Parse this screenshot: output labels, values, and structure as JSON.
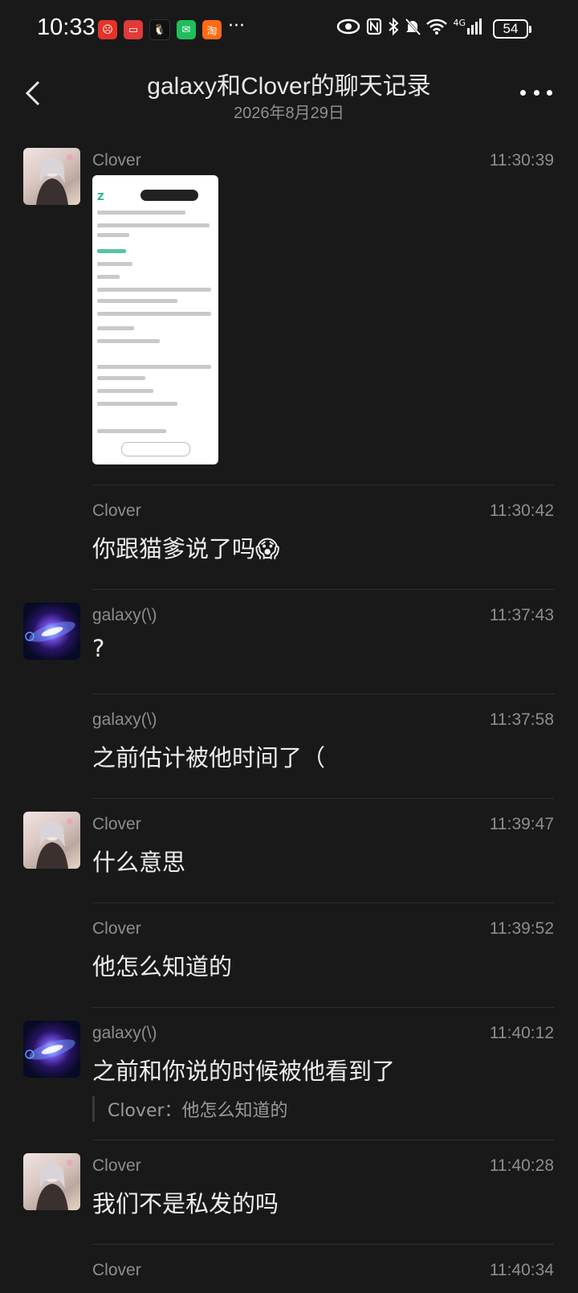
{
  "status_bar": {
    "time": "10:33",
    "app_icons": [
      "app-red-icon",
      "app-red2-icon",
      "qq-icon",
      "wechat-icon",
      "taobao-icon"
    ],
    "taobao_label": "淘",
    "overflow": "···",
    "network": "4G",
    "battery": "54"
  },
  "header": {
    "title": "galaxy和Clover的聊天记录",
    "subtitle": "2026年8月29日"
  },
  "messages": [
    {
      "sender": "Clover",
      "time": "11:30:39",
      "type": "image",
      "avatar": "clover"
    },
    {
      "sender": "Clover",
      "time": "11:30:42",
      "text": "你跟猫爹说了吗😱"
    },
    {
      "sender": "galaxy(\\)",
      "time": "11:37:43",
      "text": "?",
      "avatar": "galaxy"
    },
    {
      "sender": "galaxy(\\)",
      "time": "11:37:58",
      "text": "之前估计被他时间了（"
    },
    {
      "sender": "Clover",
      "time": "11:39:47",
      "text": "什么意思",
      "avatar": "clover"
    },
    {
      "sender": "Clover",
      "time": "11:39:52",
      "text": "他怎么知道的"
    },
    {
      "sender": "galaxy(\\)",
      "time": "11:40:12",
      "text": "之前和你说的时候被他看到了",
      "quote": "Clover：他怎么知道的",
      "avatar": "galaxy"
    },
    {
      "sender": "Clover",
      "time": "11:40:28",
      "text": "我们不是私发的吗",
      "avatar": "clover"
    },
    {
      "sender": "Clover",
      "time": "11:40:34",
      "text": ""
    }
  ],
  "colors": {
    "background": "#191919",
    "text": "#ededed",
    "meta": "#8d8d8d",
    "separator": "#2f2f2f"
  }
}
